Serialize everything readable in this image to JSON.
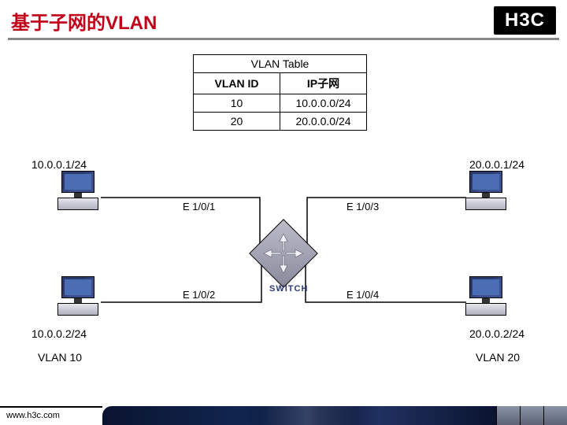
{
  "title": "基于子网的VLAN",
  "brand": "H3C",
  "table": {
    "caption": "VLAN Table",
    "headers": [
      "VLAN ID",
      "IP子网"
    ],
    "rows": [
      [
        "10",
        "10.0.0.0/24"
      ],
      [
        "20",
        "20.0.0.0/24"
      ]
    ]
  },
  "hosts": {
    "tl": "10.0.0.1/24",
    "bl": "10.0.0.2/24",
    "tr": "20.0.0.1/24",
    "br": "20.0.0.2/24"
  },
  "vlans": {
    "left": "VLAN 10",
    "right": "VLAN 20"
  },
  "ports": {
    "p1": "E 1/0/1",
    "p2": "E 1/0/2",
    "p3": "E 1/0/3",
    "p4": "E 1/0/4"
  },
  "switch_label": "SWITCH",
  "footer_url": "www.h3c.com"
}
